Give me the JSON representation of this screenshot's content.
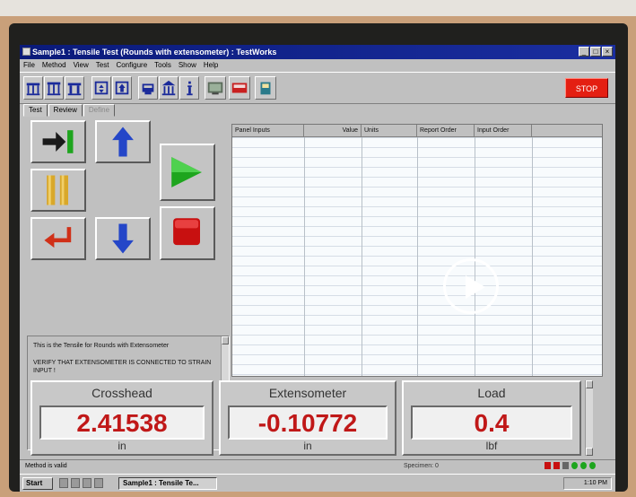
{
  "window": {
    "title": "Sample1 : Tensile Test (Rounds with extensometer) : TestWorks",
    "buttons": {
      "minimize": "_",
      "maximize": "□",
      "close": "×"
    }
  },
  "menu": [
    "File",
    "Method",
    "View",
    "Test",
    "Configure",
    "Tools",
    "Show",
    "Help"
  ],
  "toolbar": {
    "stop_label": "STOP",
    "icons": [
      "columns-icon",
      "columns-icon",
      "columns-icon",
      "arrows-icon",
      "arrows-icon",
      "calibrate-icon",
      "building-icon",
      "info-icon",
      "monitor-icon",
      "meter-icon",
      "book-icon"
    ]
  },
  "tabs": [
    {
      "label": "Test",
      "state": "active"
    },
    {
      "label": "Review",
      "state": "normal"
    },
    {
      "label": "Define",
      "state": "disabled"
    }
  ],
  "controls": {
    "icons": [
      "return-to-zero-icon",
      "jog-up-arrow-icon",
      "grip-icon",
      "start-test-play-icon",
      "return-icon",
      "jog-down-arrow-icon",
      "stop-test-square-icon"
    ]
  },
  "message": {
    "line1": "This is the Tensile for Rounds with Extensometer",
    "line2": "VERIFY THAT EXTENSOMETER IS CONNECTED TO STRAIN INPUT !"
  },
  "table": {
    "columns": [
      "Panel Inputs",
      "Value",
      "Units",
      "Report Order",
      "Input Order"
    ],
    "rows": []
  },
  "readouts": [
    {
      "label": "Crosshead",
      "value": "2.41538",
      "unit": "in"
    },
    {
      "label": "Extensometer",
      "value": "-0.10772",
      "unit": "in"
    },
    {
      "label": "Load",
      "value": "0.4",
      "unit": "lbf"
    }
  ],
  "status": {
    "left": "Method is valid",
    "middle": "Specimen: 0"
  },
  "taskbar": {
    "start_label": "Start",
    "task_label": "Sample1 : Tensile Te...",
    "clock": "1:10 PM"
  },
  "colors": {
    "title_bar": "#0a1a7a",
    "stop": "#e41f12",
    "readout_value": "#c01818",
    "play_green": "#1ea51e"
  }
}
